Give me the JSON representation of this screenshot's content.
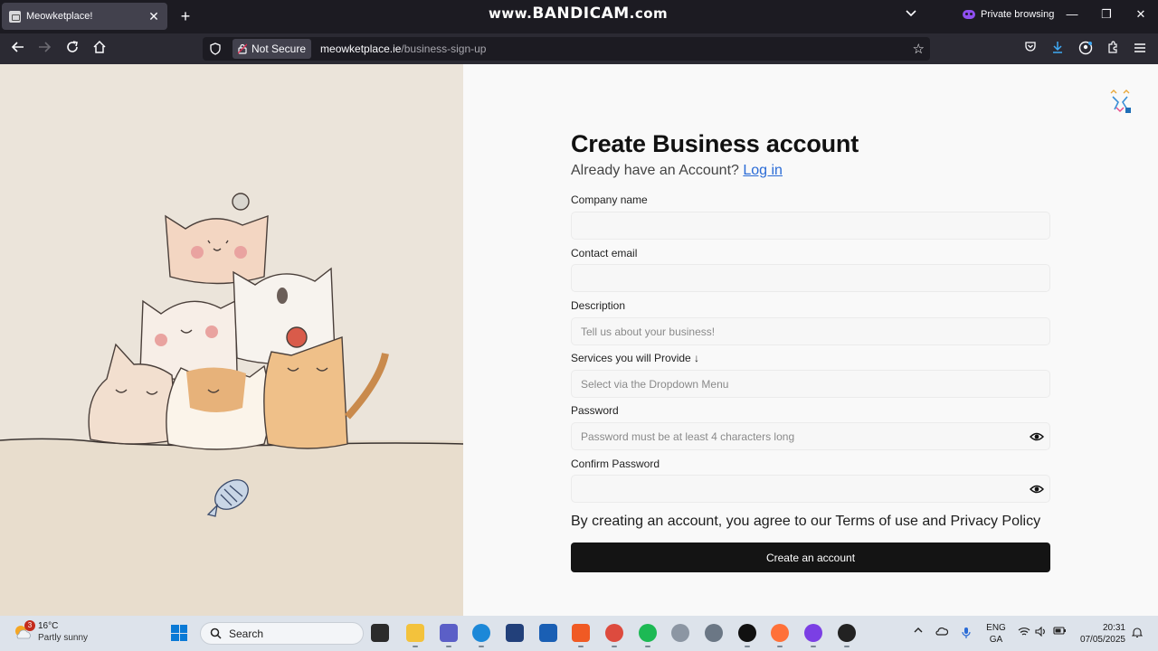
{
  "browser": {
    "tab_title": "Meowketplace!",
    "watermark_prefix": "www.",
    "watermark_brand": "BANDICAM",
    "watermark_suffix": ".com",
    "private_label": "Private browsing",
    "security_label": "Not Secure",
    "url_host": "meowketplace.ie",
    "url_path": "/business-sign-up"
  },
  "form": {
    "title": "Create Business account",
    "subtitle": "Already have an Account?",
    "login_link": "Log in",
    "company_label": "Company name",
    "company_value": "",
    "email_label": "Contact email",
    "email_value": "",
    "description_label": "Description",
    "description_placeholder": "Tell us about your business!",
    "services_label": "Services you will Provide ↓",
    "services_placeholder": "Select via the Dropdown Menu",
    "password_label": "Password",
    "password_placeholder": "Password must be at least 4 characters long",
    "confirm_label": "Confirm Password",
    "confirm_value": "",
    "terms_text": "By creating an account, you agree to our Terms of use and Privacy Policy",
    "submit_label": "Create an account"
  },
  "taskbar": {
    "weather_badge": "3",
    "temperature": "16°C",
    "condition": "Partly sunny",
    "search_label": "Search",
    "lang_top": "ENG",
    "lang_bottom": "GA",
    "time": "20:31",
    "date": "07/05/2025"
  },
  "colors": {
    "accent_link": "#2a6bd6",
    "button": "#141414",
    "private_purple": "#8f4ff0"
  }
}
